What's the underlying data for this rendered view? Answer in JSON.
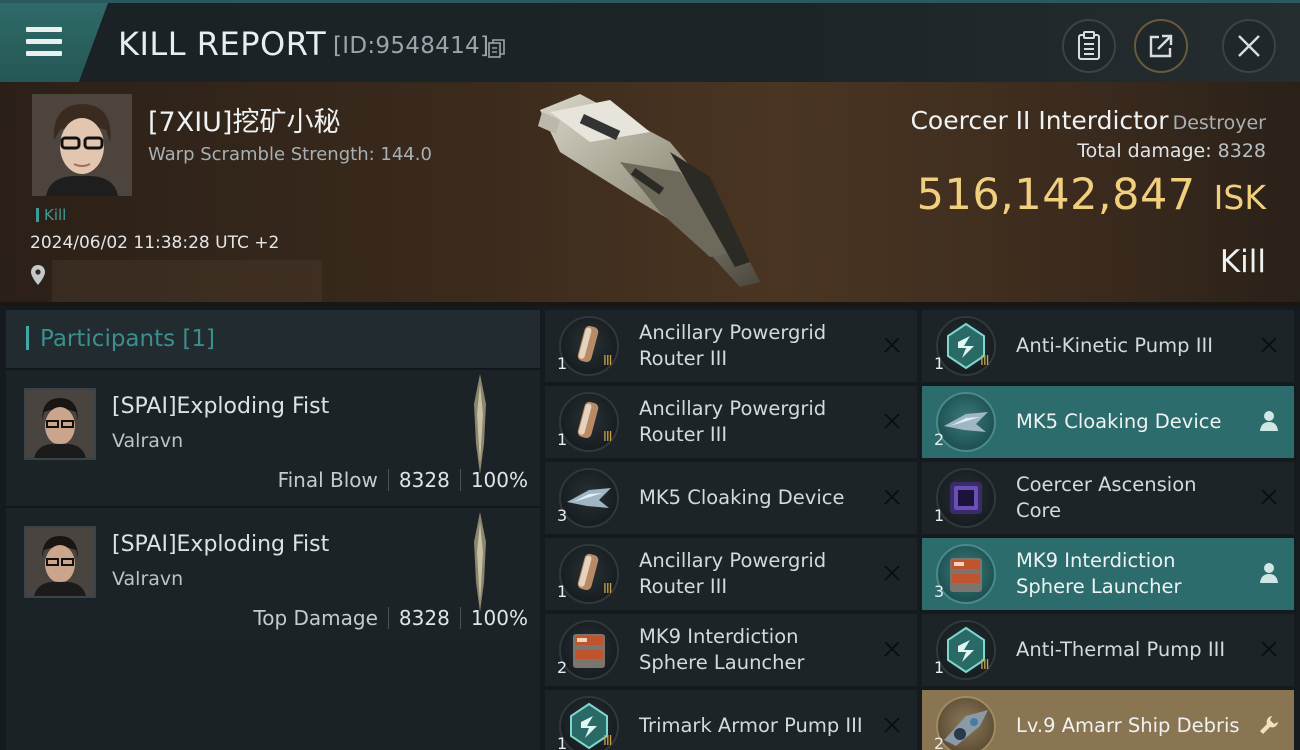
{
  "header": {
    "title": "KILL REPORT",
    "id_text": "[ID:9548414]",
    "icons": [
      "menu-icon",
      "copy-icon",
      "clipboard-icon",
      "share-icon",
      "close-icon"
    ]
  },
  "victim": {
    "name": "[7XIU]挖矿小秘",
    "warp_scramble": "Warp Scramble Strength: 144.0",
    "tag": "Kill",
    "datetime": "2024/06/02 11:38:28 UTC +2",
    "ship": "Coercer II Interdictor",
    "ship_class": "Destroyer",
    "total_damage_label": "Total damage:",
    "total_damage": "8328",
    "isk_value": "516,142,847",
    "isk_unit": "ISK",
    "result": "Kill"
  },
  "participants": {
    "title": "Participants",
    "count": "[1]",
    "rows": [
      {
        "name": "[SPAI]Exploding Fist",
        "ship": "Valravn",
        "role": "Final Blow",
        "damage": "8328",
        "percent": "100%"
      },
      {
        "name": "[SPAI]Exploding Fist",
        "ship": "Valravn",
        "role": "Top Damage",
        "damage": "8328",
        "percent": "100%"
      }
    ]
  },
  "items": {
    "left": [
      {
        "qty": "1",
        "name": "Ancillary Powergrid Router III",
        "meta": "III",
        "icon": "powergrid-router-icon",
        "status": "destroyed"
      },
      {
        "qty": "1",
        "name": "Ancillary Powergrid Router III",
        "meta": "III",
        "icon": "powergrid-router-icon",
        "status": "destroyed"
      },
      {
        "qty": "3",
        "name": "MK5 Cloaking Device",
        "meta": "",
        "icon": "cloaking-device-icon",
        "status": "destroyed"
      },
      {
        "qty": "1",
        "name": "Ancillary Powergrid Router III",
        "meta": "III",
        "icon": "powergrid-router-icon",
        "status": "destroyed"
      },
      {
        "qty": "2",
        "name": "MK9 Interdiction Sphere Launcher",
        "meta": "",
        "icon": "interdiction-launcher-icon",
        "status": "destroyed"
      },
      {
        "qty": "1",
        "name": "Trimark Armor Pump III",
        "meta": "III",
        "icon": "armor-pump-icon",
        "status": "destroyed"
      }
    ],
    "right": [
      {
        "qty": "1",
        "name": "Anti-Kinetic Pump III",
        "meta": "III",
        "icon": "armor-pump-icon",
        "status": "destroyed"
      },
      {
        "qty": "2",
        "name": "MK5 Cloaking Device",
        "meta": "",
        "icon": "cloaking-device-icon",
        "status": "dropped"
      },
      {
        "qty": "1",
        "name": "Coercer Ascension Core",
        "meta": "",
        "icon": "ascension-core-icon",
        "status": "destroyed"
      },
      {
        "qty": "3",
        "name": "MK9 Interdiction Sphere Launcher",
        "meta": "",
        "icon": "interdiction-launcher-icon",
        "status": "dropped"
      },
      {
        "qty": "1",
        "name": "Anti-Thermal Pump III",
        "meta": "III",
        "icon": "armor-pump-icon",
        "status": "destroyed"
      },
      {
        "qty": "2",
        "name": "Lv.9 Amarr Ship Debris",
        "meta": "",
        "icon": "ship-debris-icon",
        "status": "salvage"
      }
    ]
  },
  "colors": {
    "accent_teal": "#2d6c6c",
    "accent_gold": "#8a7553",
    "isk_gold": "#f0cf7e",
    "background": "#151a1e"
  }
}
